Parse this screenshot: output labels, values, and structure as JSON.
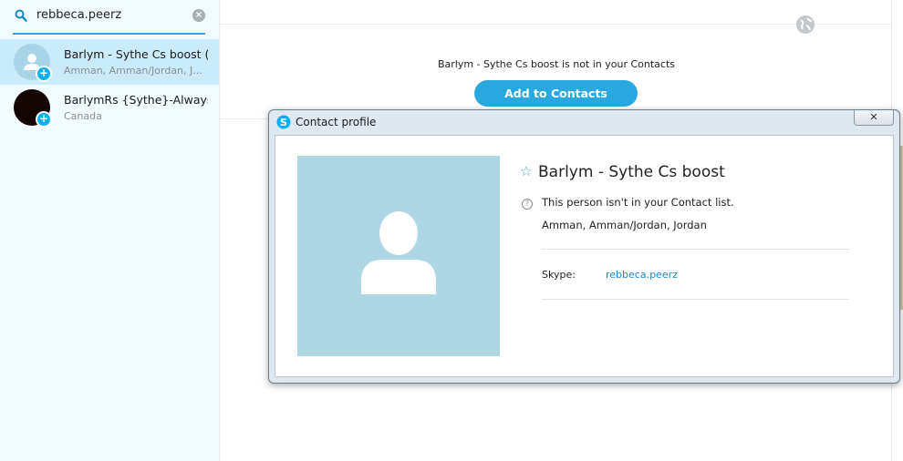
{
  "search": {
    "value": "rebbeca.peerz",
    "clear_glyph": "×"
  },
  "results": [
    {
      "name": "Barlym - Sythe Cs boost ()",
      "location": "Amman, Amman/Jordan, J...",
      "avatar": "default",
      "selected": true
    },
    {
      "name": "BarlymRs {Sythe}-Always...)",
      "location": "Canada",
      "avatar": "dark",
      "selected": false
    }
  ],
  "main": {
    "not_in_contacts": "Barlym - Sythe Cs boost is not in your Contacts",
    "add_button": "Add to Contacts"
  },
  "dialog": {
    "title": "Contact profile",
    "close_glyph": "✕",
    "name": "Barlym - Sythe Cs boost",
    "star_glyph": "☆",
    "info_glyph": "?",
    "not_in_list": "This person isn't in your Contact list.",
    "location": "Amman, Amman/Jordan, Jordan",
    "skype_label": "Skype:",
    "skype_value": "rebbeca.peerz"
  },
  "icons": {
    "search": "search-icon",
    "globe": "globe-icon",
    "skype": "skype-logo-icon",
    "user": "default-user-icon",
    "add_contact": "plus-badge-icon"
  },
  "colors": {
    "accent": "#29a8e0",
    "selected_row": "#c9ebfa",
    "photo_bg": "#aed6e3",
    "link": "#1f87c9"
  }
}
